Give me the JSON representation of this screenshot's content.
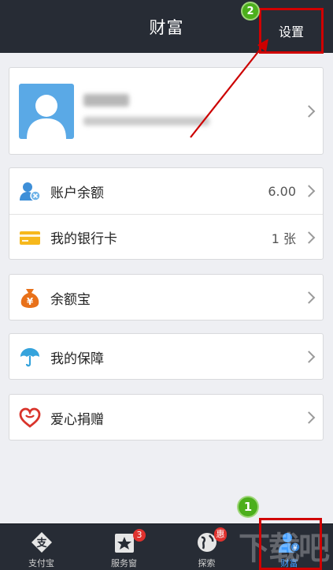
{
  "header": {
    "title": "财富",
    "settings_label": "设置"
  },
  "annotations": {
    "step_one": "1",
    "step_two": "2"
  },
  "menu": {
    "balance": {
      "label": "账户余额",
      "value": "6.00"
    },
    "bank_card": {
      "label": "我的银行卡",
      "value": "1 张"
    },
    "yuebao": {
      "label": "余额宝"
    },
    "insurance": {
      "label": "我的保障"
    },
    "donation": {
      "label": "爱心捐赠"
    }
  },
  "tabs": [
    {
      "label": "支付宝"
    },
    {
      "label": "服务窗",
      "badge": "3"
    },
    {
      "label": "探索",
      "badge": "惠"
    },
    {
      "label": "财富"
    }
  ],
  "watermark": "下载吧",
  "colors": {
    "header_bg": "#272c35",
    "accent": "#3e9bff",
    "annotation": "#d00000"
  }
}
